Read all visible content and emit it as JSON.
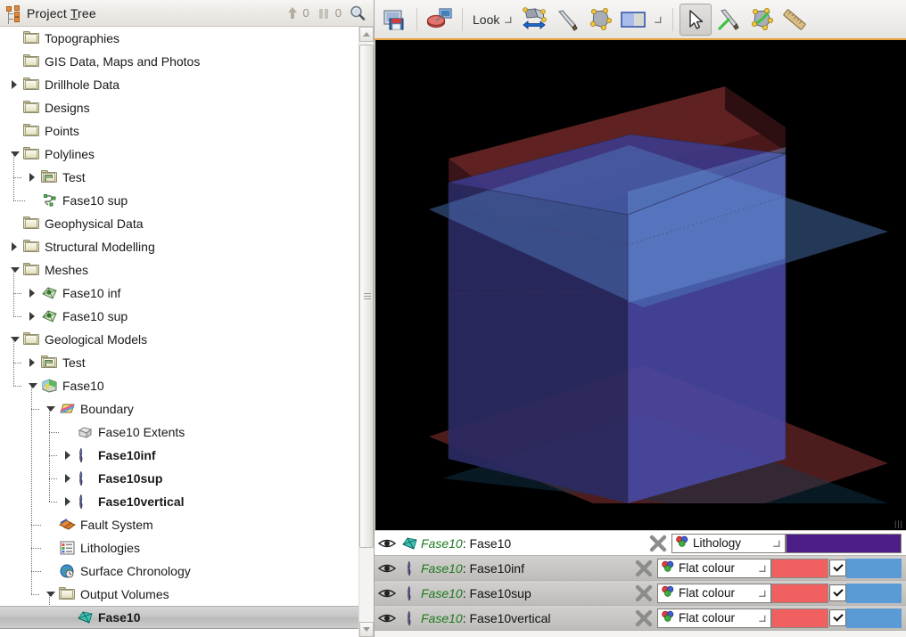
{
  "panel": {
    "title_prefix": "Project ",
    "title_accel": "T",
    "title_suffix": "ree",
    "title_full": "Project Tree",
    "upload_count": "0",
    "pending_count": "0",
    "icons": {
      "project": "project-tree-icon",
      "upload": "upload-arrow-icon",
      "pause": "pause-bars-icon",
      "search": "magnifier-icon"
    }
  },
  "tree": {
    "items": [
      {
        "label": "Topographies",
        "icon": "folder-icon",
        "depth": 1,
        "twisty": "none",
        "bold": false
      },
      {
        "label": "GIS Data, Maps and Photos",
        "icon": "folder-icon",
        "depth": 1,
        "twisty": "none",
        "bold": false
      },
      {
        "label": "Drillhole Data",
        "icon": "folder-icon",
        "depth": 1,
        "twisty": "collapsed",
        "bold": false
      },
      {
        "label": "Designs",
        "icon": "folder-icon",
        "depth": 1,
        "twisty": "none",
        "bold": false
      },
      {
        "label": "Points",
        "icon": "folder-icon",
        "depth": 1,
        "twisty": "none",
        "bold": false
      },
      {
        "label": "Polylines",
        "icon": "folder-icon",
        "depth": 1,
        "twisty": "expanded",
        "bold": false
      },
      {
        "label": "Test",
        "icon": "folder-image-icon",
        "depth": 2,
        "twisty": "collapsed",
        "bold": false
      },
      {
        "label": "Fase10 sup",
        "icon": "polyline-icon",
        "depth": 2,
        "twisty": "none",
        "bold": false
      },
      {
        "label": "Geophysical Data",
        "icon": "folder-icon",
        "depth": 1,
        "twisty": "none",
        "bold": false
      },
      {
        "label": "Structural Modelling",
        "icon": "folder-icon",
        "depth": 1,
        "twisty": "collapsed",
        "bold": false
      },
      {
        "label": "Meshes",
        "icon": "folder-icon",
        "depth": 1,
        "twisty": "expanded",
        "bold": false
      },
      {
        "label": "Fase10 inf",
        "icon": "mesh-icon",
        "depth": 2,
        "twisty": "collapsed",
        "bold": false
      },
      {
        "label": "Fase10 sup",
        "icon": "mesh-icon",
        "depth": 2,
        "twisty": "collapsed",
        "bold": false
      },
      {
        "label": "Geological Models",
        "icon": "folder-icon",
        "depth": 1,
        "twisty": "expanded",
        "bold": false
      },
      {
        "label": "Test",
        "icon": "folder-image-icon",
        "depth": 2,
        "twisty": "collapsed",
        "bold": false
      },
      {
        "label": "Fase10",
        "icon": "geological-model-icon",
        "depth": 2,
        "twisty": "expanded",
        "bold": false
      },
      {
        "label": "Boundary",
        "icon": "boundary-icon",
        "depth": 3,
        "twisty": "expanded",
        "bold": false
      },
      {
        "label": "Fase10 Extents",
        "icon": "extents-icon",
        "depth": 4,
        "twisty": "none",
        "bold": false
      },
      {
        "label": "Fase10inf",
        "icon": "vein-icon",
        "depth": 4,
        "twisty": "collapsed",
        "bold": true
      },
      {
        "label": "Fase10sup",
        "icon": "vein-icon",
        "depth": 4,
        "twisty": "collapsed",
        "bold": true
      },
      {
        "label": "Fase10vertical",
        "icon": "vein-icon",
        "depth": 4,
        "twisty": "collapsed",
        "bold": true
      },
      {
        "label": "Fault System",
        "icon": "fault-system-icon",
        "depth": 3,
        "twisty": "none",
        "bold": false
      },
      {
        "label": "Lithologies",
        "icon": "lithologies-icon",
        "depth": 3,
        "twisty": "none",
        "bold": false
      },
      {
        "label": "Surface Chronology",
        "icon": "surface-chronology-icon",
        "depth": 3,
        "twisty": "none",
        "bold": false
      },
      {
        "label": "Output Volumes",
        "icon": "folder-icon",
        "depth": 3,
        "twisty": "expanded",
        "bold": false
      },
      {
        "label": "Fase10",
        "icon": "volume-icon",
        "depth": 4,
        "twisty": "none",
        "bold": true,
        "selected": true
      }
    ]
  },
  "toolbar": {
    "save_view_label": "save-view",
    "scene_label": "scene-to-screen",
    "look_label": "Look",
    "flip_label": "flip-view",
    "knife_label": "slice-tool",
    "polygon_label": "polygon-tool",
    "split_label": "split-view",
    "pointer_label": "pointer-tool",
    "knife_green_label": "draw-slice",
    "polygon_green_label": "draw-polygon",
    "ruler_label": "measure-tool"
  },
  "shapelist": {
    "rows": [
      {
        "project": "Fase10",
        "sep": ": ",
        "name": "Fase10",
        "icon": "volume-icon",
        "colourby": "Lithology",
        "swatch": "#4c1d87",
        "wide": true,
        "has_check": false,
        "check": false,
        "swatch2": ""
      },
      {
        "project": "Fase10",
        "sep": ": ",
        "name": "Fase10inf",
        "icon": "vein-icon",
        "colourby": "Flat colour",
        "swatch": "#f06060",
        "wide": false,
        "has_check": true,
        "check": true,
        "swatch2": "#5b9bd5"
      },
      {
        "project": "Fase10",
        "sep": ": ",
        "name": "Fase10sup",
        "icon": "vein-icon",
        "colourby": "Flat colour",
        "swatch": "#f06060",
        "wide": false,
        "has_check": true,
        "check": true,
        "swatch2": "#5b9bd5"
      },
      {
        "project": "Fase10",
        "sep": ": ",
        "name": "Fase10vertical",
        "icon": "vein-icon",
        "colourby": "Flat colour",
        "swatch": "#f06060",
        "wide": false,
        "has_check": true,
        "check": true,
        "swatch2": "#5b9bd5"
      }
    ],
    "remove_icon": "remove-x-icon",
    "visibility_icon": "eye-icon"
  },
  "viewport": {
    "background": "#000000",
    "box_colour": "#4a49a6",
    "upper_plane_colour": "#8f3434",
    "lower_plane_colour": "#8f3434",
    "mid_plane_colour": "#5a86c8",
    "grip_glyph": "|||"
  },
  "colors": {
    "accent_orange": "#e8a33d",
    "panel_bg": "#f0efed",
    "tree_bg": "#ffffff",
    "selected_row": "#c2c2c2"
  }
}
